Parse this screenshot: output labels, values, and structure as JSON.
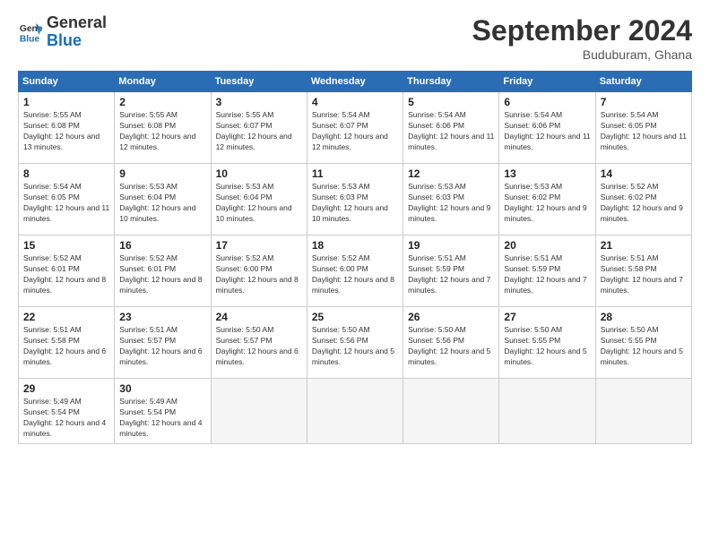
{
  "header": {
    "logo_line1": "General",
    "logo_line2": "Blue",
    "month_title": "September 2024",
    "location": "Buduburam, Ghana"
  },
  "weekdays": [
    "Sunday",
    "Monday",
    "Tuesday",
    "Wednesday",
    "Thursday",
    "Friday",
    "Saturday"
  ],
  "weeks": [
    [
      {
        "day": 1,
        "sunrise": "5:55 AM",
        "sunset": "6:08 PM",
        "daylight": "12 hours and 13 minutes."
      },
      {
        "day": 2,
        "sunrise": "5:55 AM",
        "sunset": "6:08 PM",
        "daylight": "12 hours and 12 minutes."
      },
      {
        "day": 3,
        "sunrise": "5:55 AM",
        "sunset": "6:07 PM",
        "daylight": "12 hours and 12 minutes."
      },
      {
        "day": 4,
        "sunrise": "5:54 AM",
        "sunset": "6:07 PM",
        "daylight": "12 hours and 12 minutes."
      },
      {
        "day": 5,
        "sunrise": "5:54 AM",
        "sunset": "6:06 PM",
        "daylight": "12 hours and 11 minutes."
      },
      {
        "day": 6,
        "sunrise": "5:54 AM",
        "sunset": "6:06 PM",
        "daylight": "12 hours and 11 minutes."
      },
      {
        "day": 7,
        "sunrise": "5:54 AM",
        "sunset": "6:05 PM",
        "daylight": "12 hours and 11 minutes."
      }
    ],
    [
      {
        "day": 8,
        "sunrise": "5:54 AM",
        "sunset": "6:05 PM",
        "daylight": "12 hours and 11 minutes."
      },
      {
        "day": 9,
        "sunrise": "5:53 AM",
        "sunset": "6:04 PM",
        "daylight": "12 hours and 10 minutes."
      },
      {
        "day": 10,
        "sunrise": "5:53 AM",
        "sunset": "6:04 PM",
        "daylight": "12 hours and 10 minutes."
      },
      {
        "day": 11,
        "sunrise": "5:53 AM",
        "sunset": "6:03 PM",
        "daylight": "12 hours and 10 minutes."
      },
      {
        "day": 12,
        "sunrise": "5:53 AM",
        "sunset": "6:03 PM",
        "daylight": "12 hours and 9 minutes."
      },
      {
        "day": 13,
        "sunrise": "5:53 AM",
        "sunset": "6:02 PM",
        "daylight": "12 hours and 9 minutes."
      },
      {
        "day": 14,
        "sunrise": "5:52 AM",
        "sunset": "6:02 PM",
        "daylight": "12 hours and 9 minutes."
      }
    ],
    [
      {
        "day": 15,
        "sunrise": "5:52 AM",
        "sunset": "6:01 PM",
        "daylight": "12 hours and 8 minutes."
      },
      {
        "day": 16,
        "sunrise": "5:52 AM",
        "sunset": "6:01 PM",
        "daylight": "12 hours and 8 minutes."
      },
      {
        "day": 17,
        "sunrise": "5:52 AM",
        "sunset": "6:00 PM",
        "daylight": "12 hours and 8 minutes."
      },
      {
        "day": 18,
        "sunrise": "5:52 AM",
        "sunset": "6:00 PM",
        "daylight": "12 hours and 8 minutes."
      },
      {
        "day": 19,
        "sunrise": "5:51 AM",
        "sunset": "5:59 PM",
        "daylight": "12 hours and 7 minutes."
      },
      {
        "day": 20,
        "sunrise": "5:51 AM",
        "sunset": "5:59 PM",
        "daylight": "12 hours and 7 minutes."
      },
      {
        "day": 21,
        "sunrise": "5:51 AM",
        "sunset": "5:58 PM",
        "daylight": "12 hours and 7 minutes."
      }
    ],
    [
      {
        "day": 22,
        "sunrise": "5:51 AM",
        "sunset": "5:58 PM",
        "daylight": "12 hours and 6 minutes."
      },
      {
        "day": 23,
        "sunrise": "5:51 AM",
        "sunset": "5:57 PM",
        "daylight": "12 hours and 6 minutes."
      },
      {
        "day": 24,
        "sunrise": "5:50 AM",
        "sunset": "5:57 PM",
        "daylight": "12 hours and 6 minutes."
      },
      {
        "day": 25,
        "sunrise": "5:50 AM",
        "sunset": "5:56 PM",
        "daylight": "12 hours and 5 minutes."
      },
      {
        "day": 26,
        "sunrise": "5:50 AM",
        "sunset": "5:56 PM",
        "daylight": "12 hours and 5 minutes."
      },
      {
        "day": 27,
        "sunrise": "5:50 AM",
        "sunset": "5:55 PM",
        "daylight": "12 hours and 5 minutes."
      },
      {
        "day": 28,
        "sunrise": "5:50 AM",
        "sunset": "5:55 PM",
        "daylight": "12 hours and 5 minutes."
      }
    ],
    [
      {
        "day": 29,
        "sunrise": "5:49 AM",
        "sunset": "5:54 PM",
        "daylight": "12 hours and 4 minutes."
      },
      {
        "day": 30,
        "sunrise": "5:49 AM",
        "sunset": "5:54 PM",
        "daylight": "12 hours and 4 minutes."
      },
      null,
      null,
      null,
      null,
      null
    ]
  ]
}
